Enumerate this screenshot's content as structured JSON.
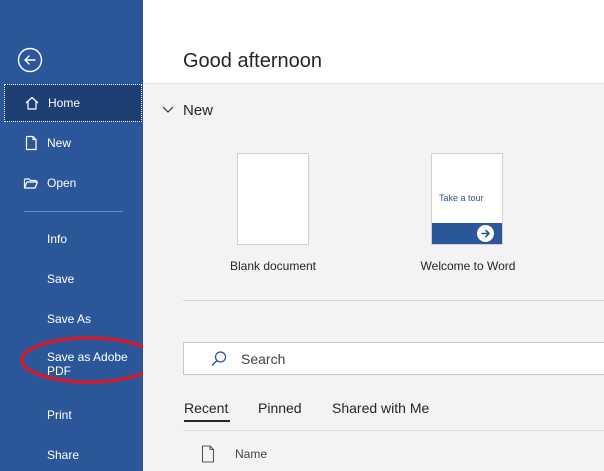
{
  "sidebar": {
    "back_icon": "back-arrow-icon",
    "items": [
      {
        "label": "Home",
        "icon": "home-icon"
      },
      {
        "label": "New",
        "icon": "new-document-icon"
      },
      {
        "label": "Open",
        "icon": "open-folder-icon"
      },
      {
        "label": "Info"
      },
      {
        "label": "Save"
      },
      {
        "label": "Save As"
      },
      {
        "label": "Save as Adobe PDF"
      },
      {
        "label": "Print"
      },
      {
        "label": "Share"
      }
    ],
    "active_item": "Home",
    "background_color": "#2b579a",
    "highlight_color": "#e8141c"
  },
  "main": {
    "greeting": "Good afternoon",
    "new_section": {
      "title": "New",
      "templates": [
        {
          "caption": "Blank document"
        },
        {
          "caption": "Welcome to Word",
          "thumbnail_text": "Take a tour"
        }
      ]
    },
    "search": {
      "placeholder": "Search"
    },
    "tabs": [
      {
        "label": "Recent",
        "selected": true
      },
      {
        "label": "Pinned"
      },
      {
        "label": "Shared with Me"
      }
    ],
    "list": {
      "columns": [
        "Name"
      ]
    }
  }
}
